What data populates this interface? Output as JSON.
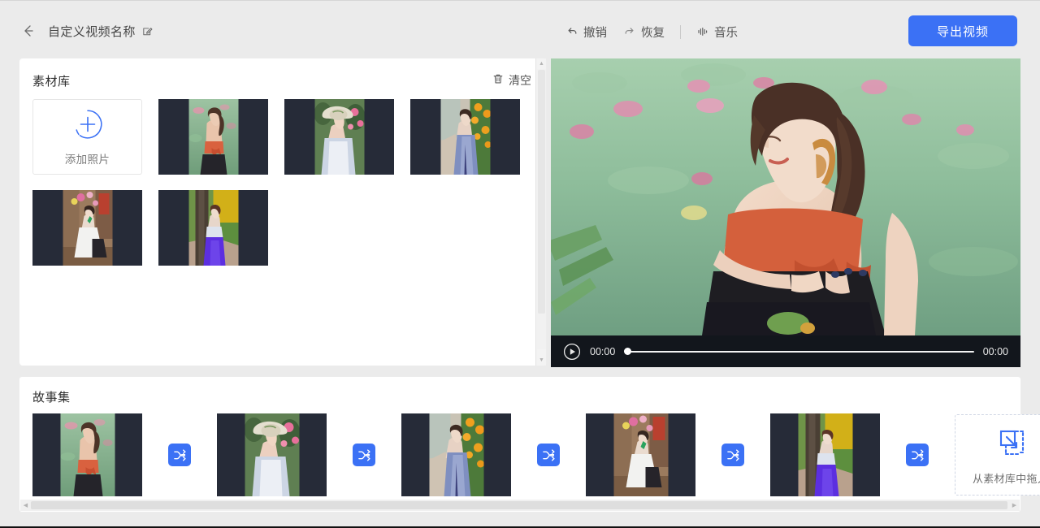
{
  "header": {
    "back_icon": "arrow-left-icon",
    "title": "自定义视频名称",
    "edit_icon": "edit-pencil-icon",
    "tools": [
      {
        "label": "撤销",
        "icon": "undo-icon"
      },
      {
        "label": "恢复",
        "icon": "redo-icon"
      },
      {
        "label": "音乐",
        "icon": "music-wave-icon"
      }
    ],
    "export_label": "导出视频"
  },
  "library": {
    "title": "素材库",
    "clear_label": "清空",
    "clear_icon": "trash-icon",
    "add_photo_label": "添加照片",
    "add_photo_icon": "plus-circle-icon",
    "items": [
      {
        "name": "lotus-pond-portrait"
      },
      {
        "name": "straw-hat-portrait"
      },
      {
        "name": "orange-flower-street-portrait"
      },
      {
        "name": "seated-white-dress-portrait"
      },
      {
        "name": "tree-purple-skirt-portrait"
      }
    ]
  },
  "preview": {
    "play_icon": "play-circle-icon",
    "current_time": "00:00",
    "duration": "00:00",
    "progress_percent": 0
  },
  "story": {
    "title": "故事集",
    "transition_icon": "shuffle-icon",
    "clips": [
      {
        "name": "lotus-pond-portrait"
      },
      {
        "name": "straw-hat-portrait"
      },
      {
        "name": "orange-flower-street-portrait"
      },
      {
        "name": "seated-white-dress-portrait"
      },
      {
        "name": "tree-purple-skirt-portrait"
      }
    ],
    "dropzone_label": "从素材库中拖入",
    "dropzone_icon": "drag-into-icon"
  },
  "colors": {
    "accent": "#3b71f5",
    "page_bg": "#ebebeb",
    "panel_bg": "#ffffff",
    "thumb_bg": "#262b38",
    "player_bg": "#12161c"
  }
}
